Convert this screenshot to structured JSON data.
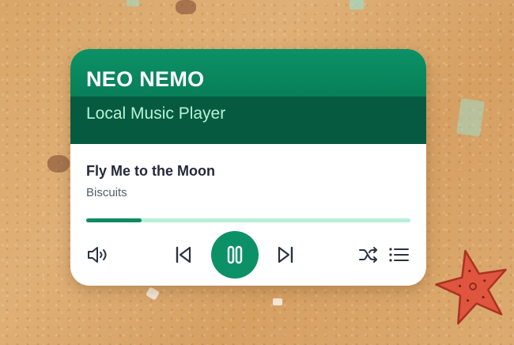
{
  "app": {
    "title": "NEO NEMO",
    "subtitle": "Local Music Player"
  },
  "track": {
    "title": "Fly Me to the Moon",
    "artist": "Biscuits"
  },
  "playback": {
    "progress_fraction": 0.17,
    "state": "playing"
  },
  "controls": {
    "volume_icon": "volume-icon",
    "previous_icon": "skip-previous-icon",
    "play_pause_icon": "pause-icon",
    "next_icon": "skip-next-icon",
    "shuffle_icon": "shuffle-icon",
    "playlist_icon": "playlist-icon"
  },
  "colors": {
    "accent": "#0c9166",
    "header_dark": "#065a40",
    "subtitle": "#b8f2d6",
    "progress_track": "#b6f0d6",
    "icon": "#2b3140"
  }
}
